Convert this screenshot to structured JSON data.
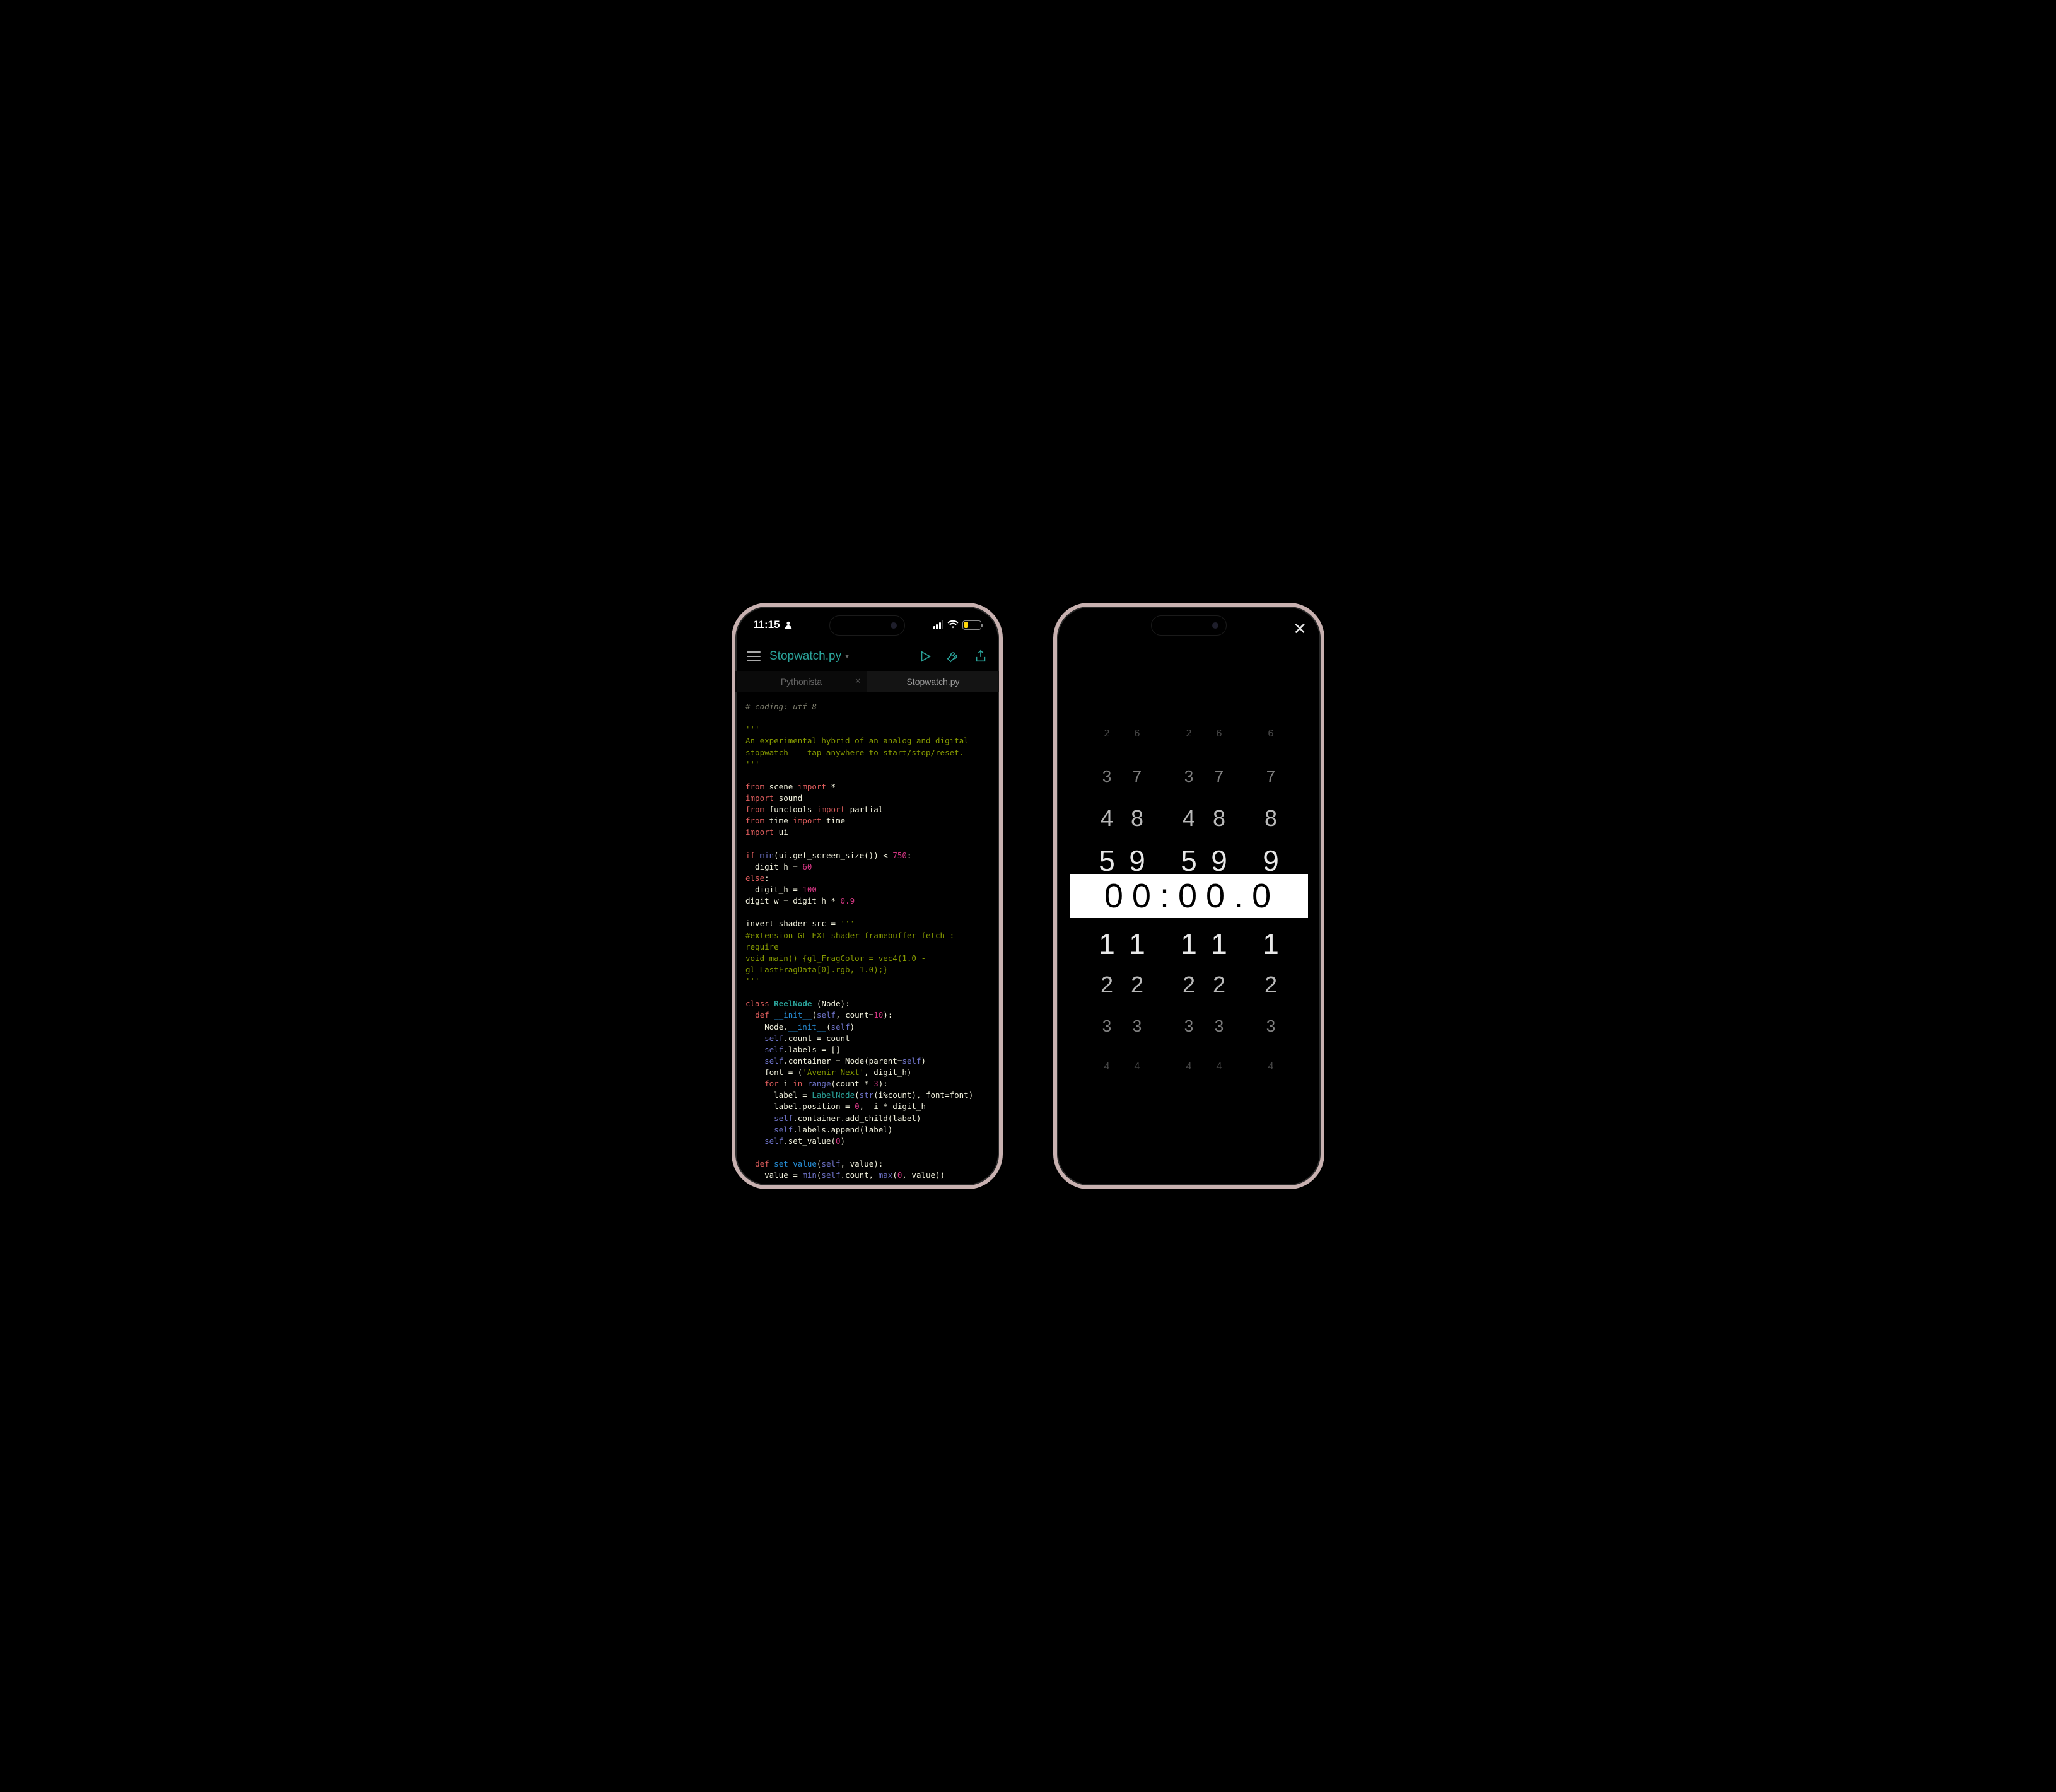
{
  "statusbar": {
    "time": "11:15",
    "battery_level": "25"
  },
  "editor": {
    "filename": "Stopwatch.py",
    "tabs": [
      "Pythonista",
      "Stopwatch.py"
    ],
    "active_tab": 1,
    "code_tokens": [
      [
        {
          "cls": "tok-comment",
          "t": "# coding: utf-8"
        }
      ],
      [],
      [
        {
          "cls": "tok-string",
          "t": "'''"
        }
      ],
      [
        {
          "cls": "tok-string",
          "t": "An experimental hybrid of an analog and digital"
        }
      ],
      [
        {
          "cls": "tok-string",
          "t": "stopwatch -- tap anywhere to start/stop/reset."
        }
      ],
      [
        {
          "cls": "tok-string",
          "t": "'''"
        }
      ],
      [],
      [
        {
          "cls": "tok-keyword",
          "t": "from"
        },
        {
          "cls": "tok-name",
          "t": " scene "
        },
        {
          "cls": "tok-keyword",
          "t": "import"
        },
        {
          "cls": "tok-name",
          "t": " *"
        }
      ],
      [
        {
          "cls": "tok-keyword",
          "t": "import"
        },
        {
          "cls": "tok-name",
          "t": " sound"
        }
      ],
      [
        {
          "cls": "tok-keyword",
          "t": "from"
        },
        {
          "cls": "tok-name",
          "t": " functools "
        },
        {
          "cls": "tok-keyword",
          "t": "import"
        },
        {
          "cls": "tok-name",
          "t": " partial"
        }
      ],
      [
        {
          "cls": "tok-keyword",
          "t": "from"
        },
        {
          "cls": "tok-name",
          "t": " time "
        },
        {
          "cls": "tok-keyword",
          "t": "import"
        },
        {
          "cls": "tok-name",
          "t": " time"
        }
      ],
      [
        {
          "cls": "tok-keyword",
          "t": "import"
        },
        {
          "cls": "tok-name",
          "t": " ui"
        }
      ],
      [],
      [
        {
          "cls": "tok-keyword",
          "t": "if"
        },
        {
          "cls": "tok-name",
          "t": " "
        },
        {
          "cls": "tok-builtin",
          "t": "min"
        },
        {
          "cls": "tok-name",
          "t": "(ui.get_screen_size()) < "
        },
        {
          "cls": "tok-number",
          "t": "750"
        },
        {
          "cls": "tok-name",
          "t": ":"
        }
      ],
      [
        {
          "cls": "tok-name",
          "t": "  digit_h = "
        },
        {
          "cls": "tok-number",
          "t": "60"
        }
      ],
      [
        {
          "cls": "tok-keyword",
          "t": "else"
        },
        {
          "cls": "tok-name",
          "t": ":"
        }
      ],
      [
        {
          "cls": "tok-name",
          "t": "  digit_h = "
        },
        {
          "cls": "tok-number",
          "t": "100"
        }
      ],
      [
        {
          "cls": "tok-name",
          "t": "digit_w = digit_h * "
        },
        {
          "cls": "tok-number",
          "t": "0.9"
        }
      ],
      [],
      [
        {
          "cls": "tok-name",
          "t": "invert_shader_src = "
        },
        {
          "cls": "tok-string",
          "t": "'''"
        }
      ],
      [
        {
          "cls": "tok-string",
          "t": "#extension GL_EXT_shader_framebuffer_fetch : "
        }
      ],
      [
        {
          "cls": "tok-string",
          "t": "require"
        }
      ],
      [
        {
          "cls": "tok-string",
          "t": "void main() {gl_FragColor = vec4(1.0 - "
        }
      ],
      [
        {
          "cls": "tok-string",
          "t": "gl_LastFragData[0].rgb, 1.0);}"
        }
      ],
      [
        {
          "cls": "tok-string",
          "t": "'''"
        }
      ],
      [],
      [
        {
          "cls": "tok-keyword",
          "t": "class"
        },
        {
          "cls": "tok-name",
          "t": " "
        },
        {
          "cls": "tok-classname",
          "t": "ReelNode"
        },
        {
          "cls": "tok-name",
          "t": " (Node):"
        }
      ],
      [
        {
          "cls": "tok-name",
          "t": "  "
        },
        {
          "cls": "tok-keyword",
          "t": "def"
        },
        {
          "cls": "tok-name",
          "t": " "
        },
        {
          "cls": "tok-funcname",
          "t": "__init__"
        },
        {
          "cls": "tok-name",
          "t": "("
        },
        {
          "cls": "tok-self",
          "t": "self"
        },
        {
          "cls": "tok-name",
          "t": ", count="
        },
        {
          "cls": "tok-number",
          "t": "10"
        },
        {
          "cls": "tok-name",
          "t": "):"
        }
      ],
      [
        {
          "cls": "tok-name",
          "t": "    Node."
        },
        {
          "cls": "tok-funcname",
          "t": "__init__"
        },
        {
          "cls": "tok-name",
          "t": "("
        },
        {
          "cls": "tok-self",
          "t": "self"
        },
        {
          "cls": "tok-name",
          "t": ")"
        }
      ],
      [
        {
          "cls": "tok-name",
          "t": "    "
        },
        {
          "cls": "tok-self",
          "t": "self"
        },
        {
          "cls": "tok-name",
          "t": ".count = count"
        }
      ],
      [
        {
          "cls": "tok-name",
          "t": "    "
        },
        {
          "cls": "tok-self",
          "t": "self"
        },
        {
          "cls": "tok-name",
          "t": ".labels = []"
        }
      ],
      [
        {
          "cls": "tok-name",
          "t": "    "
        },
        {
          "cls": "tok-self",
          "t": "self"
        },
        {
          "cls": "tok-name",
          "t": ".container = Node(parent="
        },
        {
          "cls": "tok-self",
          "t": "self"
        },
        {
          "cls": "tok-name",
          "t": ")"
        }
      ],
      [
        {
          "cls": "tok-name",
          "t": "    font = ("
        },
        {
          "cls": "tok-string",
          "t": "'Avenir Next'"
        },
        {
          "cls": "tok-name",
          "t": ", digit_h)"
        }
      ],
      [
        {
          "cls": "tok-name",
          "t": "    "
        },
        {
          "cls": "tok-keyword",
          "t": "for"
        },
        {
          "cls": "tok-name",
          "t": " i "
        },
        {
          "cls": "tok-keyword",
          "t": "in"
        },
        {
          "cls": "tok-name",
          "t": " "
        },
        {
          "cls": "tok-builtin",
          "t": "range"
        },
        {
          "cls": "tok-name",
          "t": "(count * "
        },
        {
          "cls": "tok-number",
          "t": "3"
        },
        {
          "cls": "tok-name",
          "t": "):"
        }
      ],
      [
        {
          "cls": "tok-name",
          "t": "      label = "
        },
        {
          "cls": "tok-type",
          "t": "LabelNode"
        },
        {
          "cls": "tok-name",
          "t": "("
        },
        {
          "cls": "tok-builtin",
          "t": "str"
        },
        {
          "cls": "tok-name",
          "t": "(i%count), font=font)"
        }
      ],
      [
        {
          "cls": "tok-name",
          "t": "      label.position = "
        },
        {
          "cls": "tok-number",
          "t": "0"
        },
        {
          "cls": "tok-name",
          "t": ", -i * digit_h"
        }
      ],
      [
        {
          "cls": "tok-name",
          "t": "      "
        },
        {
          "cls": "tok-self",
          "t": "self"
        },
        {
          "cls": "tok-name",
          "t": ".container.add_child(label)"
        }
      ],
      [
        {
          "cls": "tok-name",
          "t": "      "
        },
        {
          "cls": "tok-self",
          "t": "self"
        },
        {
          "cls": "tok-name",
          "t": ".labels.append(label)"
        }
      ],
      [
        {
          "cls": "tok-name",
          "t": "    "
        },
        {
          "cls": "tok-self",
          "t": "self"
        },
        {
          "cls": "tok-name",
          "t": ".set_value("
        },
        {
          "cls": "tok-number",
          "t": "0"
        },
        {
          "cls": "tok-name",
          "t": ")"
        }
      ],
      [],
      [
        {
          "cls": "tok-name",
          "t": "  "
        },
        {
          "cls": "tok-keyword",
          "t": "def"
        },
        {
          "cls": "tok-name",
          "t": " "
        },
        {
          "cls": "tok-funcname",
          "t": "set_value"
        },
        {
          "cls": "tok-name",
          "t": "("
        },
        {
          "cls": "tok-self",
          "t": "self"
        },
        {
          "cls": "tok-name",
          "t": ", value):"
        }
      ],
      [
        {
          "cls": "tok-name",
          "t": "    value = "
        },
        {
          "cls": "tok-builtin",
          "t": "min"
        },
        {
          "cls": "tok-name",
          "t": "("
        },
        {
          "cls": "tok-self",
          "t": "self"
        },
        {
          "cls": "tok-name",
          "t": ".count, "
        },
        {
          "cls": "tok-builtin",
          "t": "max"
        },
        {
          "cls": "tok-name",
          "t": "("
        },
        {
          "cls": "tok-number",
          "t": "0"
        },
        {
          "cls": "tok-name",
          "t": ", value))"
        }
      ]
    ]
  },
  "stopwatch": {
    "center": [
      "0",
      "0",
      ":",
      "0",
      "0",
      ".",
      "0"
    ],
    "layers": [
      {
        "offset": -4,
        "size": 16,
        "opacity": 0.3,
        "digits": [
          "2",
          "6",
          "",
          "2",
          "6",
          "",
          "6"
        ]
      },
      {
        "offset": -3,
        "size": 26,
        "opacity": 0.55,
        "digits": [
          "3",
          "7",
          "",
          "3",
          "7",
          "",
          "7"
        ]
      },
      {
        "offset": -2,
        "size": 36,
        "opacity": 0.8,
        "digits": [
          "4",
          "8",
          "",
          "4",
          "8",
          "",
          "8"
        ]
      },
      {
        "offset": -1,
        "size": 46,
        "opacity": 1.0,
        "digits": [
          "5",
          "9",
          "",
          "5",
          "9",
          "",
          "9"
        ]
      },
      {
        "offset": 1,
        "size": 46,
        "opacity": 1.0,
        "digits": [
          "1",
          "1",
          "",
          "1",
          "1",
          "",
          "1"
        ]
      },
      {
        "offset": 2,
        "size": 36,
        "opacity": 0.8,
        "digits": [
          "2",
          "2",
          "",
          "2",
          "2",
          "",
          "2"
        ]
      },
      {
        "offset": 3,
        "size": 26,
        "opacity": 0.55,
        "digits": [
          "3",
          "3",
          "",
          "3",
          "3",
          "",
          "3"
        ]
      },
      {
        "offset": 4,
        "size": 16,
        "opacity": 0.3,
        "digits": [
          "4",
          "4",
          "",
          "4",
          "4",
          "",
          "4"
        ]
      }
    ]
  }
}
